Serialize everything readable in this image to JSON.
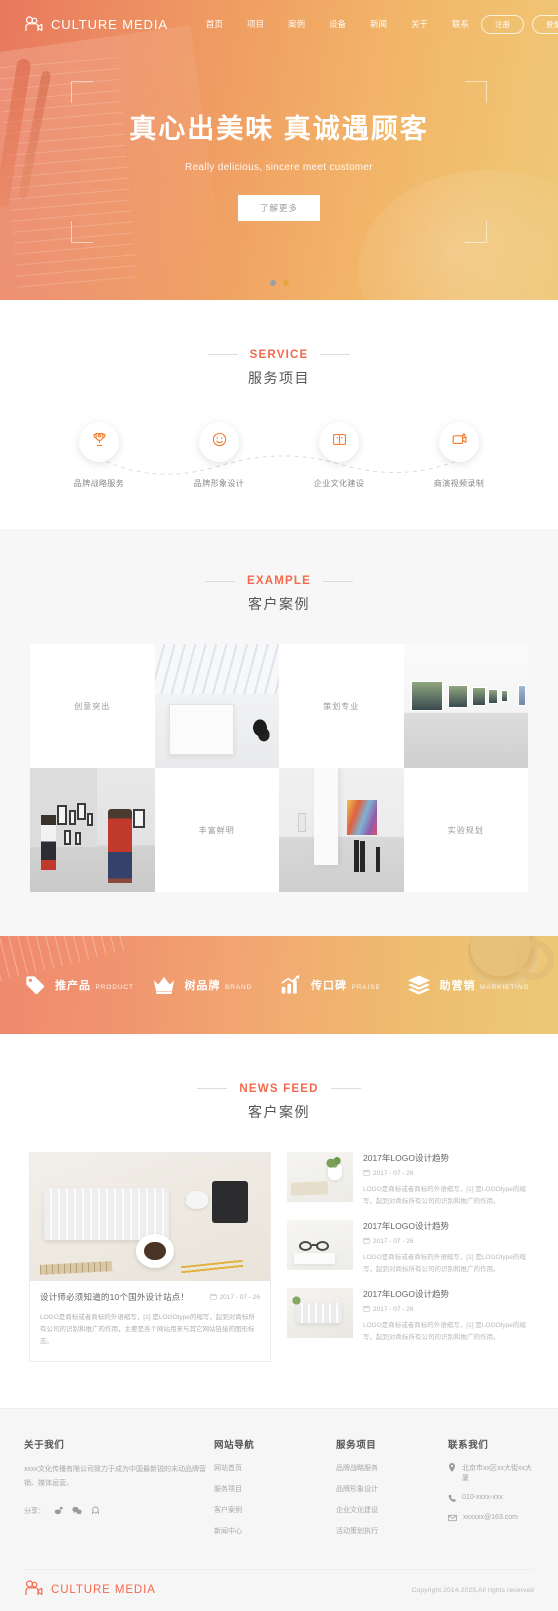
{
  "brand": {
    "name": "CULTURE MEDIA",
    "logo_icon": "camera-icon"
  },
  "nav": {
    "items": [
      {
        "label": "首页"
      },
      {
        "label": "项目"
      },
      {
        "label": "案例"
      },
      {
        "label": "设备"
      },
      {
        "label": "新闻"
      },
      {
        "label": "关于"
      },
      {
        "label": "联系"
      }
    ],
    "register_label": "注册",
    "login_label": "登录"
  },
  "hero": {
    "title": "真心出美味  真诚遇顾客",
    "subtitle": "Really delicious, sincere meet customer",
    "button_label": "了解更多",
    "dots": [
      {
        "active": false
      },
      {
        "active": true
      }
    ]
  },
  "service": {
    "en": "SERVICE",
    "cn": "服务项目",
    "items": [
      {
        "label": "品牌战略服务",
        "icon": "trophy-icon"
      },
      {
        "label": "品牌形象设计",
        "icon": "smiley-icon"
      },
      {
        "label": "企业文化建设",
        "icon": "book-icon"
      },
      {
        "label": "商演视频录制",
        "icon": "video-icon"
      }
    ]
  },
  "example": {
    "en": "EXAMPLE",
    "cn": "客户案例",
    "cells": [
      {
        "type": "text",
        "label": "创意突出"
      },
      {
        "type": "image",
        "style": "ph-ceiling",
        "alt": "gallery-ceiling-photo"
      },
      {
        "type": "text",
        "label": "策划专业"
      },
      {
        "type": "image",
        "style": "ph-hall",
        "alt": "gallery-hall-photo"
      },
      {
        "type": "image",
        "style": "ph-people",
        "alt": "gallery-visitors-photo"
      },
      {
        "type": "text",
        "label": "丰富鲜明"
      },
      {
        "type": "image",
        "style": "ph-gallery",
        "alt": "gallery-artwork-photo"
      },
      {
        "type": "text",
        "label": "实验规划"
      }
    ]
  },
  "banner": {
    "items": [
      {
        "cn": "推产品",
        "en": "PRODUCT",
        "icon": "tag-icon"
      },
      {
        "cn": "树品牌",
        "en": "BRAND",
        "icon": "crown-icon"
      },
      {
        "cn": "传口碑",
        "en": "PRAISE",
        "icon": "chart-up-icon"
      },
      {
        "cn": "助营销",
        "en": "MARKIETING",
        "icon": "layers-icon"
      }
    ]
  },
  "news": {
    "en": "NEWS FEED",
    "cn": "客户案例",
    "featured": {
      "title": "设计师必须知道的10个国外设计站点！",
      "date": "2017 - 07 - 26",
      "desc": "LOGO是商标或者商标的外语缩写，[1] 是LOGOtype的缩写，起到对商标所有公司的识别和推广的作用，主要是各个网站用来与其它网站链接的图形标志。",
      "image": "ph-desk"
    },
    "items": [
      {
        "title": "2017年LOGO设计趋势",
        "date": "2017 - 07 - 26",
        "desc": "LOGO是商标或者商标的外语缩写，[1] 是LOGOtype的缩写，起到对商标所有公司的识别和推广的作用。",
        "image": "ph-plant"
      },
      {
        "title": "2017年LOGO设计趋势",
        "date": "2017 - 07 - 26",
        "desc": "LOGO是商标或者商标的外语缩写，[1] 是LOGOtype的缩写，起到对商标所有公司的识别和推广的作用。",
        "image": "ph-glasses"
      },
      {
        "title": "2017年LOGO设计趋势",
        "date": "2017 - 07 - 26",
        "desc": "LOGO是商标或者商标的外语缩写，[1] 是LOGOtype的缩写，起到对商标所有公司的识别和推广的作用。",
        "image": "ph-kb2"
      }
    ]
  },
  "footer": {
    "about": {
      "title": "关于我们",
      "text": "xxxx文化传播有限公司致力于成为中国最新锐的未动品牌营销、媒体运营。",
      "share_label": "分享：",
      "share_icons": [
        "weibo-icon",
        "wechat-icon",
        "qq-icon"
      ]
    },
    "sitenav": {
      "title": "网站导航",
      "links": [
        "网站首页",
        "服务项目",
        "客户案例",
        "新闻中心"
      ]
    },
    "services": {
      "title": "服务项目",
      "links": [
        "品牌战略服务",
        "品牌形象设计",
        "企业文化建设",
        "活动策划执行"
      ]
    },
    "contact": {
      "title": "联系我们",
      "items": [
        {
          "icon": "location-icon",
          "text": "北京市xx区xx大街xx大厦"
        },
        {
          "icon": "phone-icon",
          "text": "010-xxxx-xxx"
        },
        {
          "icon": "mail-icon",
          "text": "xxxxxx@163.com"
        }
      ]
    },
    "brand_name": "CULTURE MEDIA",
    "copyright": "Copyright  2014-2025,All rights reserved"
  },
  "colors": {
    "accent": "#f4694b",
    "hero_left": "#e8785c",
    "hero_right": "#eec878",
    "dot_active": "#e8a33d"
  }
}
